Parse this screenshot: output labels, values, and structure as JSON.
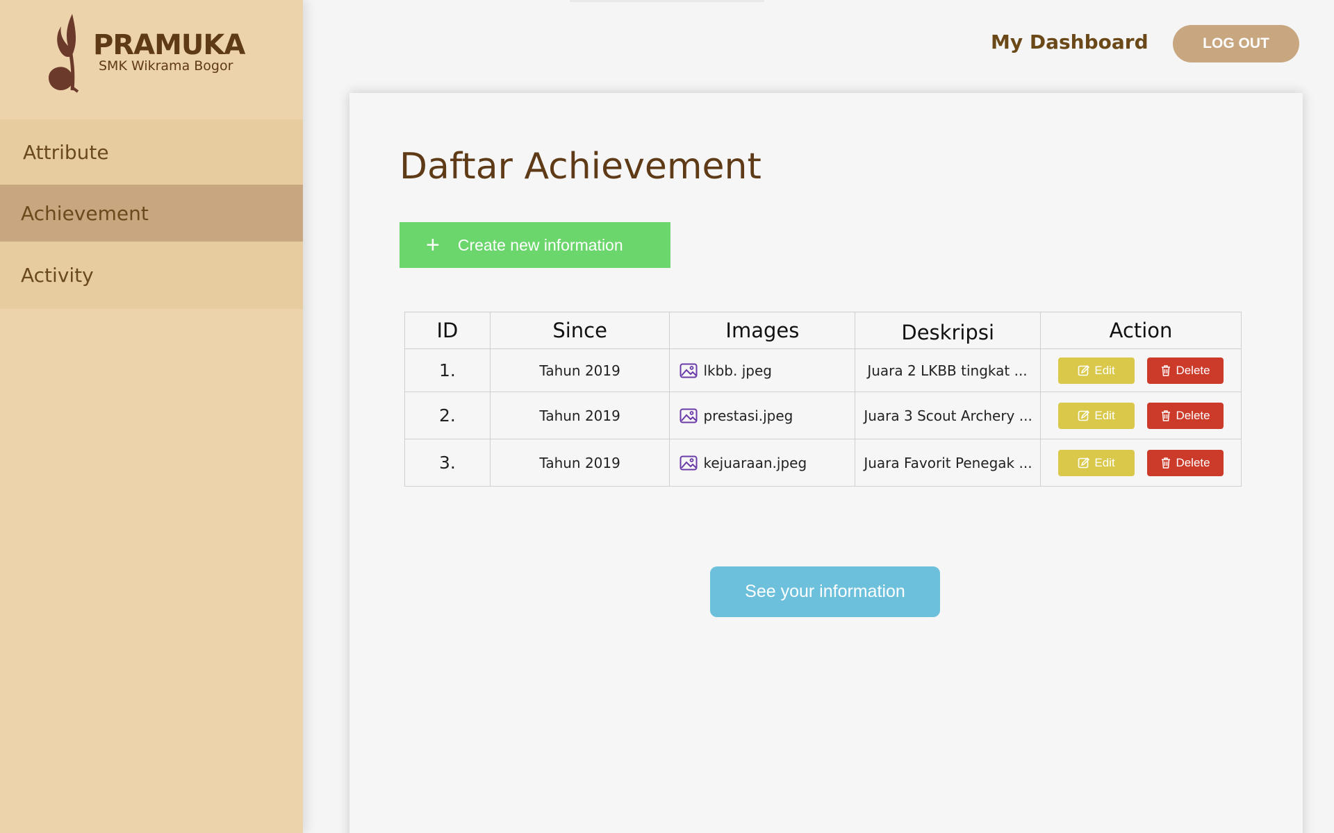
{
  "brand": {
    "title": "PRAMUKA",
    "subtitle": "SMK Wikrama Bogor"
  },
  "sidebar": {
    "items": [
      {
        "label": "Attribute",
        "active": false
      },
      {
        "label": "Achievement",
        "active": true
      },
      {
        "label": "Activity",
        "active": false
      }
    ]
  },
  "header": {
    "title": "My Dashboard",
    "logout_label": "LOG OUT"
  },
  "main": {
    "title": "Daftar Achievement",
    "create_label": "Create new information",
    "see_label": "See your information",
    "table": {
      "headers": [
        "ID",
        "Since",
        "Images",
        "Deskripsi",
        "Action"
      ],
      "rows": [
        {
          "id": "1.",
          "since": "Tahun 2019",
          "image": "lkbb. jpeg",
          "desc": "Juara 2 LKBB tingkat ..."
        },
        {
          "id": "2.",
          "since": "Tahun 2019",
          "image": "prestasi.jpeg",
          "desc": "Juara 3 Scout Archery ..."
        },
        {
          "id": "3.",
          "since": "Tahun 2019",
          "image": "kejuaraan.jpeg",
          "desc": "Juara Favorit Penegak ..."
        }
      ],
      "edit_label": "Edit",
      "delete_label": "Delete"
    }
  },
  "colors": {
    "sidebar_bg": "#ecd3ab",
    "active_item": "#c8a680",
    "create_button": "#6bd66c",
    "edit_button": "#d9c84a",
    "delete_button": "#cc3a2a",
    "see_button": "#6cc0dc",
    "text_brown": "#5e3a16"
  },
  "icons": {
    "logo": "scout-flame-logo-icon",
    "create": "plus-icon",
    "image": "image-icon",
    "edit": "edit-icon",
    "delete": "trash-icon"
  }
}
